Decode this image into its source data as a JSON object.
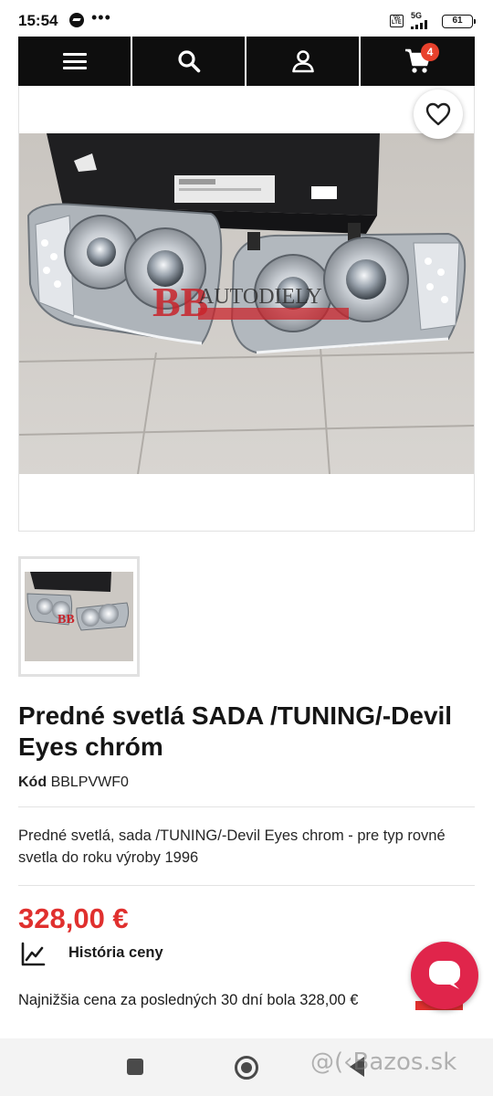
{
  "status_bar": {
    "time": "15:54",
    "dots": "•••",
    "volte": "Vo LTE",
    "network": "5G",
    "battery": "61"
  },
  "header": {
    "items": [
      {
        "name": "menu-icon"
      },
      {
        "name": "search-icon"
      },
      {
        "name": "user-icon"
      },
      {
        "name": "cart-icon"
      }
    ],
    "cart_count": "4",
    "cart_badge_color": "#e8412c"
  },
  "product": {
    "image_watermark": "AUTODIELY",
    "title": "Predné svetlá SADA /TUNING/-Devil Eyes chróm",
    "code_label": "Kód",
    "code_value": "BBLPVWF0",
    "description": "Predné svetlá, sada /TUNING/-Devil Eyes chrom - pre typ rovné svetla do roku výroby 1996",
    "price": "328,00 €",
    "price_color": "#e0302e",
    "history_label": "História ceny",
    "lowest_price_note": "Najnižšia cena za posledných 30 dní bola 328,00 €"
  },
  "watermark": "@(‹Bazos.sk"
}
